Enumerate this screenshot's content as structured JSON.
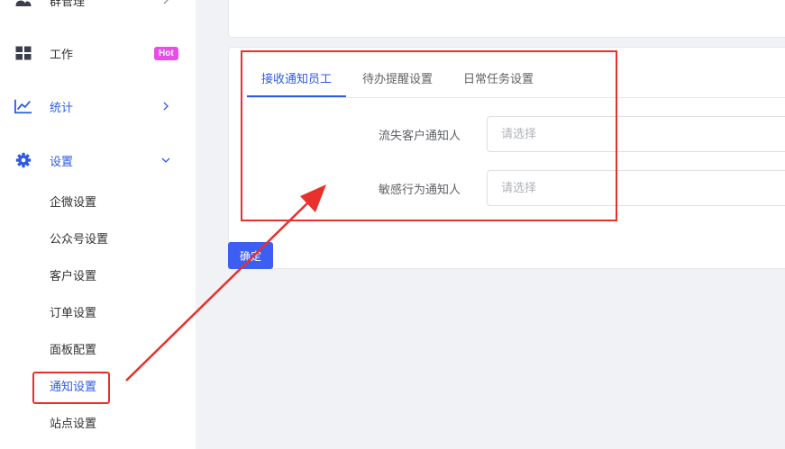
{
  "sidebar": {
    "items": [
      {
        "label": "群管理",
        "icon": "users-icon",
        "arrow": "chevron-right-icon"
      },
      {
        "label": "工作",
        "icon": "grid-icon",
        "badge": "Hot"
      },
      {
        "label": "统计",
        "icon": "trend-chart-icon",
        "arrow": "chevron-right-icon"
      },
      {
        "label": "设置",
        "icon": "gear-icon",
        "arrow": "chevron-down-icon"
      }
    ],
    "sub_items": [
      {
        "label": "企微设置"
      },
      {
        "label": "公众号设置"
      },
      {
        "label": "客户设置"
      },
      {
        "label": "订单设置"
      },
      {
        "label": "面板配置"
      },
      {
        "label": "通知设置"
      },
      {
        "label": "站点设置"
      }
    ]
  },
  "tabs": [
    {
      "label": "接收通知员工",
      "active": true
    },
    {
      "label": "待办提醒设置",
      "active": false
    },
    {
      "label": "日常任务设置",
      "active": false
    }
  ],
  "form": {
    "fields": [
      {
        "label": "流失客户通知人",
        "placeholder": "请选择",
        "value": ""
      },
      {
        "label": "敏感行为通知人",
        "placeholder": "请选择",
        "value": ""
      }
    ]
  },
  "confirm_label": "确定",
  "colors": {
    "accent": "#2f5be5",
    "button": "#3d5ef2",
    "hot_badge": "#e84de8",
    "annotation": "#e8302c"
  }
}
